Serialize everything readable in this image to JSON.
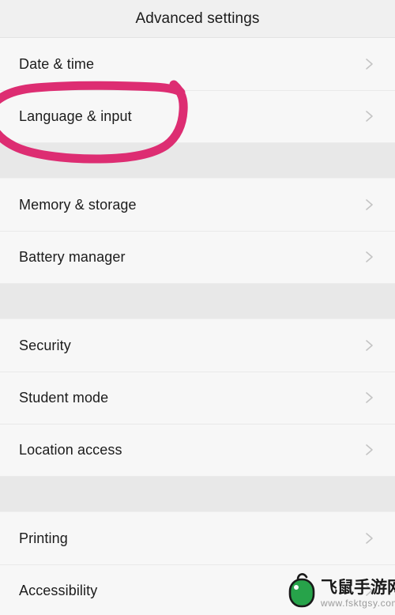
{
  "header": {
    "title": "Advanced settings"
  },
  "colors": {
    "page_background": "#f7f7f7",
    "header_background": "#f0f0f0",
    "section_gap": "#e8e8e8",
    "row_text": "#1c1c1c",
    "divider": "#e9e9e9",
    "chevron": "#c4c4c4",
    "annotation_pink": "#dd2d72",
    "watermark_green": "#27a34a",
    "watermark_text": "#1a1a1a",
    "watermark_url": "#9b9b9b"
  },
  "groups": [
    {
      "name": "group-1",
      "items": [
        {
          "label": "Date & time",
          "icon": "chevron-right-icon",
          "annotated": false
        },
        {
          "label": "Language & input",
          "icon": "chevron-right-icon",
          "annotated": true
        }
      ]
    },
    {
      "name": "group-2",
      "items": [
        {
          "label": "Memory & storage",
          "icon": "chevron-right-icon",
          "annotated": false
        },
        {
          "label": "Battery manager",
          "icon": "chevron-right-icon",
          "annotated": false
        }
      ]
    },
    {
      "name": "group-3",
      "items": [
        {
          "label": "Security",
          "icon": "chevron-right-icon",
          "annotated": false
        },
        {
          "label": "Student mode",
          "icon": "chevron-right-icon",
          "annotated": false
        },
        {
          "label": "Location access",
          "icon": "chevron-right-icon",
          "annotated": false
        }
      ]
    },
    {
      "name": "group-4",
      "items": [
        {
          "label": "Printing",
          "icon": "chevron-right-icon",
          "annotated": false
        },
        {
          "label": "Accessibility",
          "icon": "chevron-right-icon",
          "annotated": false
        }
      ]
    }
  ],
  "annotation": {
    "shape": "hand-drawn-ellipse",
    "target_label": "Language & input",
    "color": "#dd2d72"
  },
  "watermark": {
    "icon": "computer-mouse-icon",
    "site_name": "飞鼠手游网",
    "url": "www.fsktgsy.com"
  }
}
